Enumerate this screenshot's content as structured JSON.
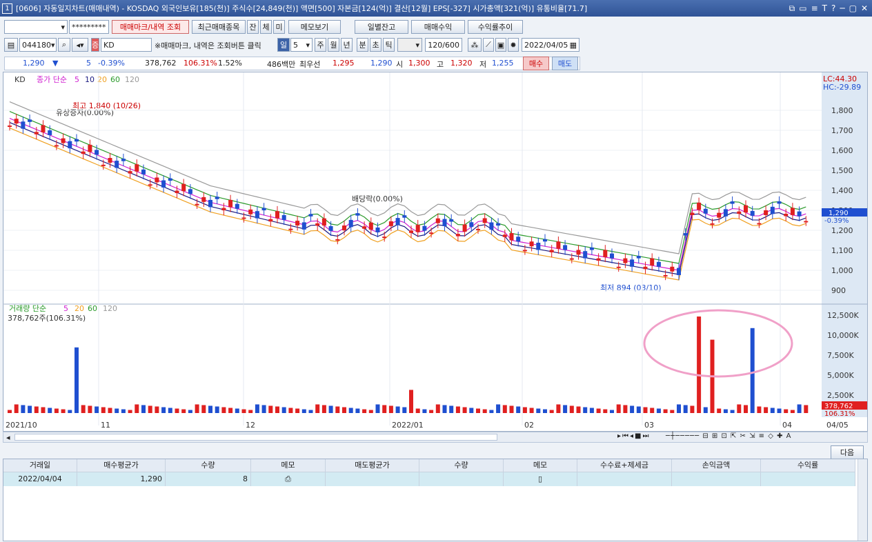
{
  "window": {
    "number": "1",
    "title": "[0606] 자동일지차트(매매내역) - KOSDAQ 외국인보유[185(천)] 주식수[24,849(천)] 액면[500] 자본금[124(억)] 결산[12월] EPS[-327] 시가총액[321(억)] 유통비율[71.7]",
    "icons": [
      "⧉",
      "▭",
      "≡",
      "T",
      "?",
      "─",
      "▢",
      "✕"
    ]
  },
  "toolbar1": {
    "account": "",
    "password": "*********",
    "buttons": [
      "매매마크/내역 조회",
      "최근매매종목",
      "잔",
      "체",
      "미",
      "메모보기",
      "일별잔고",
      "매매수익",
      "수익률추이"
    ]
  },
  "toolbar2": {
    "code": "044180",
    "name": "KD",
    "notice": "※매매마크, 내역은 조회버튼 클릭",
    "period_sel": "일",
    "period_num": "5",
    "periods": [
      "주",
      "월",
      "년",
      "분",
      "초",
      "틱"
    ],
    "count": "120/600",
    "date": "2022/04/05"
  },
  "info": {
    "price": "1,290",
    "change": "5",
    "change_pct": "-0.39%",
    "volume": "378,762",
    "vol_ratio": "106.31%",
    "turnover": "1.52%",
    "amount": "486백만",
    "best_bid_label": "최우선",
    "bid": "1,295",
    "ask": "1,290",
    "open_label": "시",
    "open": "1,300",
    "high_label": "고",
    "high": "1,320",
    "low_label": "저",
    "low": "1,255",
    "buy_label": "매수",
    "sell_label": "매도"
  },
  "price_legend": {
    "name": "KD",
    "ma_label": "종가 단순",
    "mas": [
      "5",
      "10",
      "20",
      "60",
      "120"
    ],
    "lc": "LC:44.30",
    "hc": "HC:-29.89"
  },
  "volume_legend": {
    "label": "거래량 단순",
    "mas": [
      "5",
      "20",
      "60",
      "120"
    ],
    "value": "378,762주(106.31%)"
  },
  "annotations": {
    "high": "최고 1,840 (10/26)",
    "rights": "유상증자(0.00%)",
    "dividend": "배당락(0.00%)",
    "low": "최저 894 (03/10)"
  },
  "price_axis": [
    "1,800",
    "1,700",
    "1,600",
    "1,500",
    "1,400",
    "1,300",
    "1,200",
    "1,100",
    "1,000",
    "900"
  ],
  "price_tag": {
    "value": "1,290",
    "pct": "-0.39%"
  },
  "vol_axis": [
    "12,500K",
    "10,000K",
    "7,500K",
    "5,000K",
    "2,500K"
  ],
  "vol_tag": {
    "value": "378,762",
    "pct": "106.31%"
  },
  "x_axis": [
    "2021/10",
    "11",
    "12",
    "2022/01",
    "02",
    "03",
    "04",
    "04/05"
  ],
  "colors": {
    "up": "#e02020",
    "down": "#1f4fd0",
    "ma5": "#d020d0",
    "ma10": "#1a1a80",
    "ma20": "#f0a020",
    "ma60": "#2a9a2a",
    "ma120": "#999999"
  },
  "grid": {
    "next_button": "다음",
    "columns": [
      "거래일",
      "매수평균가",
      "수량",
      "메모",
      "매도평균가",
      "수량",
      "메모",
      "수수료+제세금",
      "손익금액",
      "수익률"
    ],
    "rows": [
      [
        "2022/04/04",
        "1,290",
        "8",
        "",
        "",
        "",
        "",
        "",
        "",
        ""
      ]
    ]
  }
}
